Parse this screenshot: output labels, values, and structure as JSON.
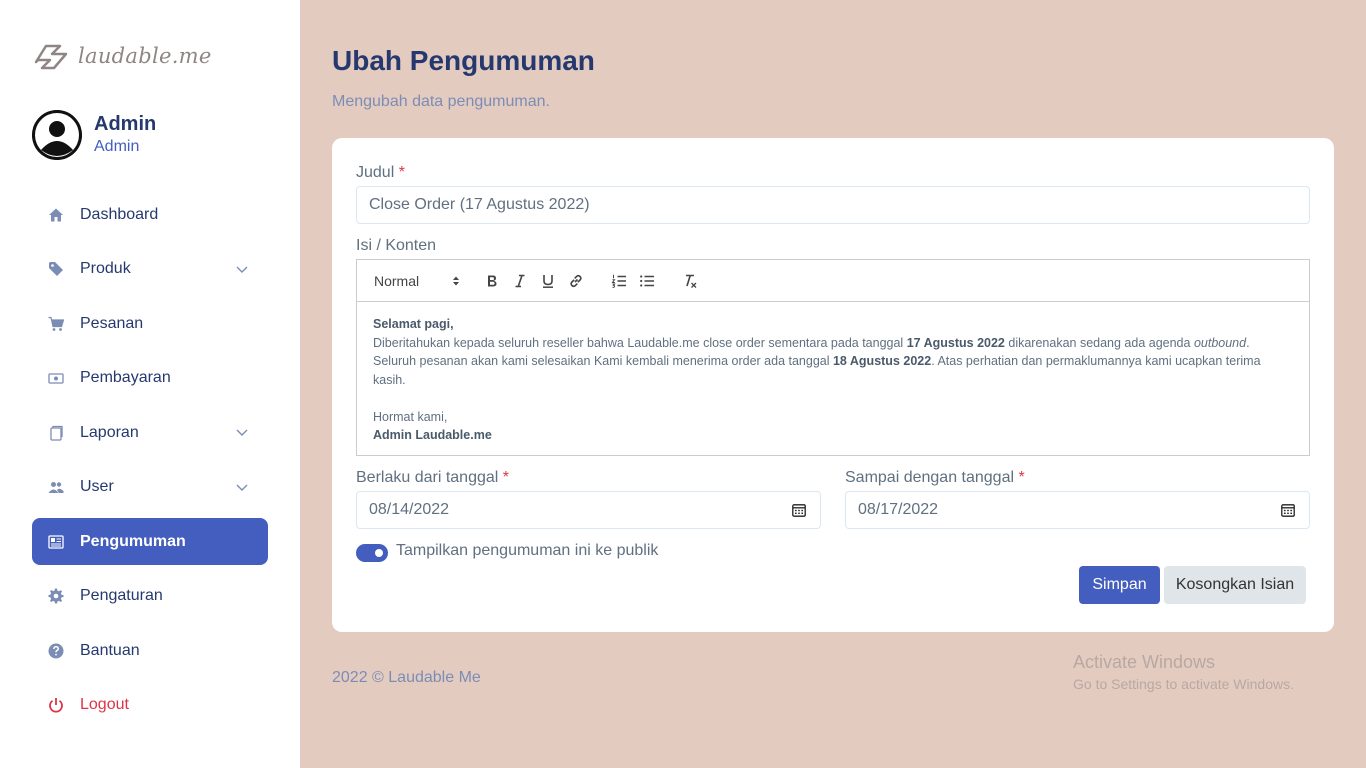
{
  "brand": {
    "logo_text": "laudable.me"
  },
  "profile": {
    "name": "Admin",
    "role": "Admin"
  },
  "sidebar": {
    "items": [
      {
        "label": "Dashboard",
        "icon": "home-icon"
      },
      {
        "label": "Produk",
        "icon": "tag-icon",
        "has_submenu": true
      },
      {
        "label": "Pesanan",
        "icon": "cart-icon"
      },
      {
        "label": "Pembayaran",
        "icon": "cash-icon"
      },
      {
        "label": "Laporan",
        "icon": "document-icon",
        "has_submenu": true
      },
      {
        "label": "User",
        "icon": "users-icon",
        "has_submenu": true
      },
      {
        "label": "Pengumuman",
        "icon": "newspaper-icon",
        "active": true
      },
      {
        "label": "Pengaturan",
        "icon": "gear-icon"
      },
      {
        "label": "Bantuan",
        "icon": "question-icon"
      },
      {
        "label": "Logout",
        "icon": "power-icon"
      }
    ]
  },
  "page": {
    "title": "Ubah Pengumuman",
    "subtitle": "Mengubah data pengumuman."
  },
  "form": {
    "title_label": "Judul",
    "title_value": "Close Order (17 Agustus 2022)",
    "content_label": "Isi / Konten",
    "editor": {
      "format_select": "Normal",
      "greeting": "Selamat pagi,",
      "p1_a": "Diberitahukan kepada seluruh reseller bahwa Laudable.me close order sementara pada tanggal ",
      "p1_b": "17 Agustus 2022",
      "p1_c": " dikarenakan sedang ada agenda ",
      "p1_d": "outbound",
      "p1_e": ". Seluruh pesanan akan kami selesaikan Kami kembali menerima order ada tanggal ",
      "p1_f": "18 Agustus 2022",
      "p1_g": ". Atas perhatian dan permaklumannya kami ucapkan terima kasih.",
      "closing": "Hormat kami,",
      "signature": "Admin Laudable.me"
    },
    "start_label": "Berlaku dari tanggal",
    "start_value": "08/14/2022",
    "end_label": "Sampai dengan tanggal",
    "end_value": "08/17/2022",
    "required_mark": "*",
    "public_toggle_label": "Tampilkan pengumuman ini ke publik",
    "public_toggle_on": true,
    "save_button": "Simpan",
    "reset_button": "Kosongkan Isian"
  },
  "footer": {
    "text": "2022 © Laudable Me"
  },
  "watermark": {
    "line1": "Activate Windows",
    "line2": "Go to Settings to activate Windows."
  },
  "colors": {
    "primary": "#435ebe",
    "background": "#e4cbc0",
    "danger": "#dc3545",
    "heading": "#25396f"
  }
}
